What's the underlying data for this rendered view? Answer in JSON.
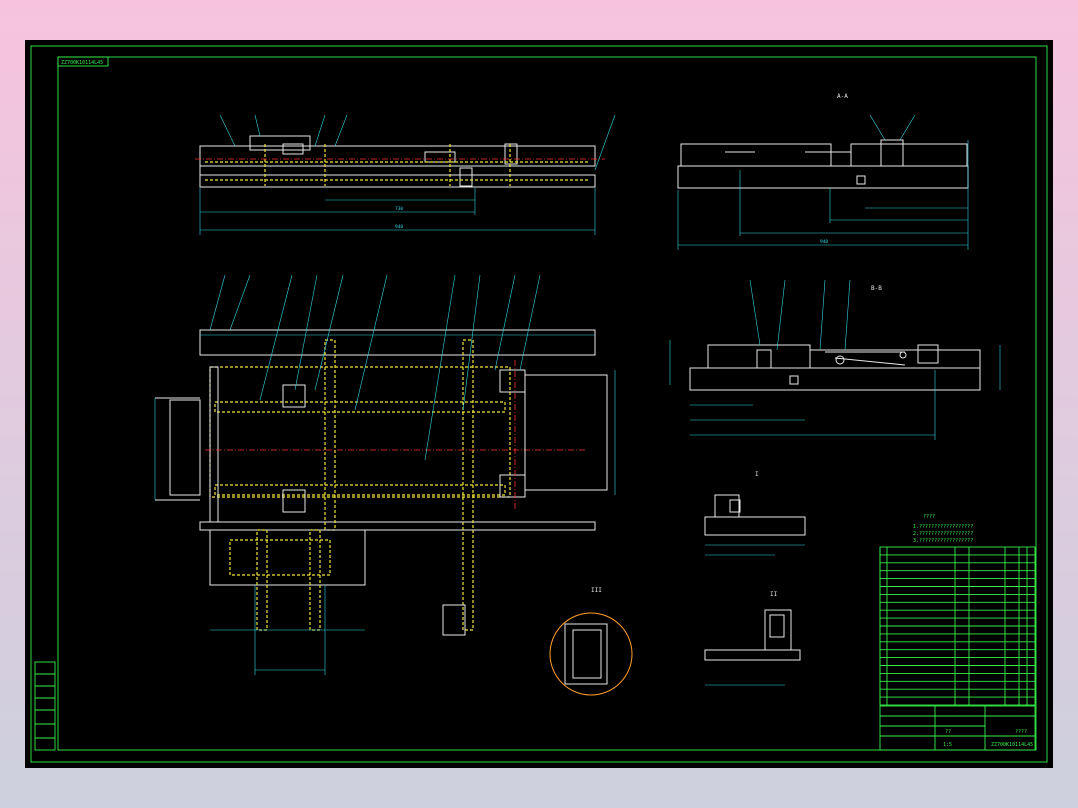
{
  "drawing": {
    "sheet_tag": "ZZ700K10114L45",
    "title_block_drawing_no": "ZZ700K10114L45",
    "view_label_a": "A-A",
    "view_label_b": "B-B",
    "view_label_c": "I",
    "view_label_d": "II",
    "view_label_e": "III",
    "notes_title": "????",
    "notes": [
      "1.??????????????????",
      "2.??????????????????",
      "3.??????????????????"
    ],
    "scale_text": "1:5",
    "sheet_text": "??",
    "title_block_name": "????"
  },
  "colors": {
    "frame": "#37f04a",
    "outline": "#e8e8e8",
    "dimension": "#2fd6e2",
    "hidden": "#f1e23a",
    "center": "#ff3030",
    "background": "#000000"
  }
}
